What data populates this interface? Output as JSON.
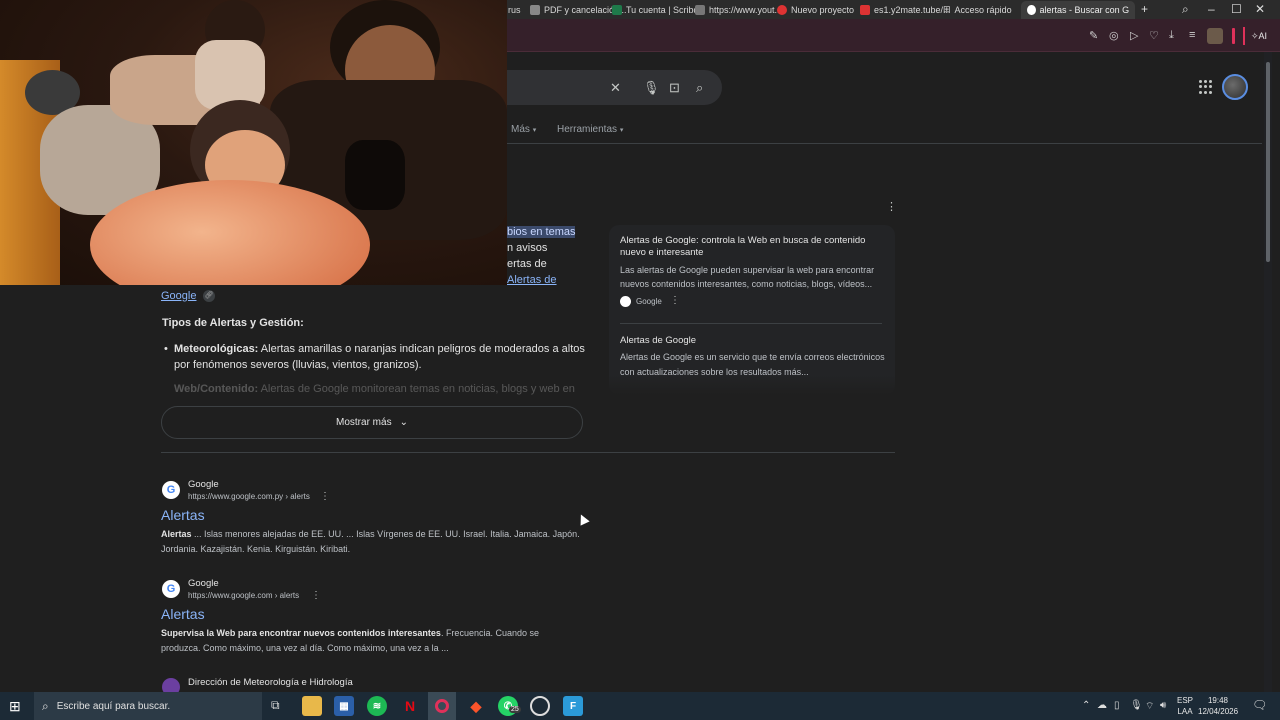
{
  "browser": {
    "bookmarks": [
      {
        "label": "rus"
      },
      {
        "label": "PDF y cancelación..."
      },
      {
        "label": "Tu cuenta | Scribd"
      },
      {
        "label": "https://www.yout..."
      },
      {
        "label": "Nuevo proyecto"
      },
      {
        "label": "es1.y2mate.tube/..."
      },
      {
        "label": "Acceso rápido"
      }
    ],
    "active_tab": "alertas - Buscar con Goog",
    "ai_label": "AI"
  },
  "search": {
    "nav_more": "Más",
    "nav_tools": "Herramientas"
  },
  "ai_overview": {
    "hl_text": "bios en temas",
    "line2": "n avisos",
    "line3": "ertas de",
    "line4_link": "Alertas de",
    "line5_link": "Google",
    "section_title": "Tipos de Alertas y Gestión:",
    "bullet1_bold": "Meteorológicas:",
    "bullet1_text": " Alertas amarillas o naranjas indican peligros de moderados a altos",
    "bullet1_cont": "por fenómenos severos (lluvias, vientos, granizos).",
    "bullet2_bold": "Web/Contenido:",
    "bullet2_text": " Alertas de Google monitorean temas en noticias, blogs y web en",
    "show_more": "Mostrar más"
  },
  "side_panel": {
    "card1_title": "Alertas de Google: controla la Web en busca de contenido nuevo e interesante",
    "card1_desc": "Las alertas de Google pueden supervisar la web para encontrar nuevos contenidos interesantes, como noticias, blogs, vídeos...",
    "card1_source": "Google",
    "card2_title": "Alertas de Google",
    "card2_desc": "Alertas de Google es un servicio que te envía correos electrónicos con actualizaciones sobre los resultados más..."
  },
  "results": [
    {
      "site": "Google",
      "url": "https://www.google.com.py › alerts",
      "title": "Alertas",
      "snippet_bold": "Alertas",
      "snippet": " ... Islas menores alejadas de EE. UU. ... Islas Vírgenes de EE. UU. Israel. Italia. Jamaica. Japón.",
      "snippet2": "Jordania. Kazajistán. Kenia. Kirguistán. Kiribati."
    },
    {
      "site": "Google",
      "url": "https://www.google.com › alerts",
      "title": "Alertas",
      "snippet_bold": "Supervisa la Web para encontrar nuevos contenidos interesantes",
      "snippet": ". Frecuencia. Cuando se",
      "snippet2": "produzca. Como máximo, una vez al día. Como máximo, una vez a la ..."
    },
    {
      "site": "Dirección de Meteorología e Hidrología"
    }
  ],
  "taskbar": {
    "search_placeholder": "Escribe aquí para buscar.",
    "whatsapp_badge": "25",
    "lang1": "ESP",
    "lang2": "LAA",
    "time": "19:48",
    "date": "12/04/2026"
  }
}
